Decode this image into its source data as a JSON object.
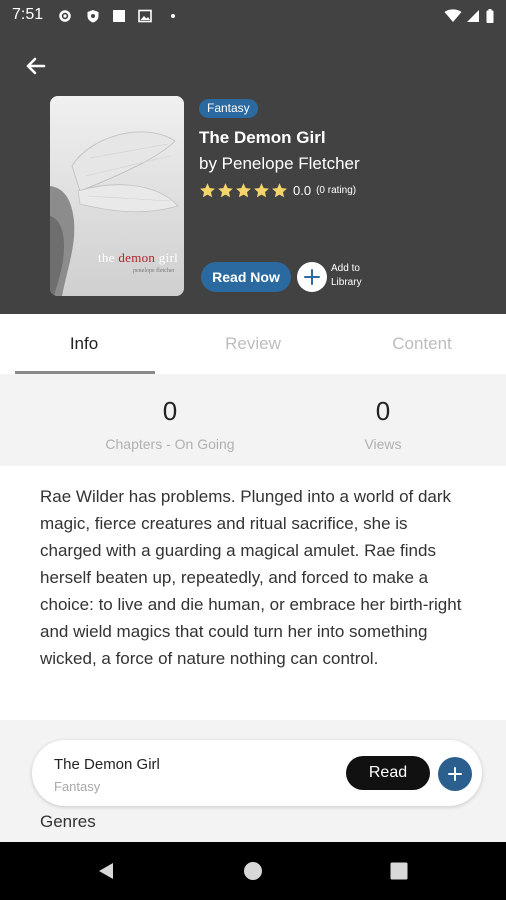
{
  "status_bar": {
    "time": "7:51"
  },
  "book": {
    "genre": "Fantasy",
    "title": "The Demon Girl",
    "author": "by Penelope Fletcher",
    "rating": "0.0",
    "rating_count": "(0 rating)",
    "stars": 5,
    "cover_text": {
      "word1": "the ",
      "word2": "demon",
      "word3": " girl",
      "author": "penelope fletcher"
    }
  },
  "actions": {
    "read_now": "Read Now",
    "add_to_library": "Add to Library"
  },
  "tabs": [
    {
      "label": "Info",
      "active": true
    },
    {
      "label": "Review",
      "active": false
    },
    {
      "label": "Content",
      "active": false
    }
  ],
  "stats": {
    "chapters": {
      "value": "0",
      "label": "Chapters - On Going"
    },
    "views": {
      "value": "0",
      "label": "Views"
    }
  },
  "description": "Rae Wilder has problems. Plunged into a world of dark magic, fierce creatures and ritual sacrifice, she is charged with a guarding a magical amulet. Rae finds herself beaten up, repeatedly, and forced to make a choice: to live and die human, or embrace her birth-right and wield magics that could turn her into something wicked, a force of nature nothing can control.",
  "card": {
    "title": "The Demon Girl",
    "genre": "Fantasy",
    "read_label": "Read"
  },
  "genres_heading": "Genres",
  "colors": {
    "header_bg": "#424242",
    "accent_blue": "#2b6aa1",
    "star_yellow": "#f5d46a",
    "panel_bg": "#f3f3f3"
  }
}
